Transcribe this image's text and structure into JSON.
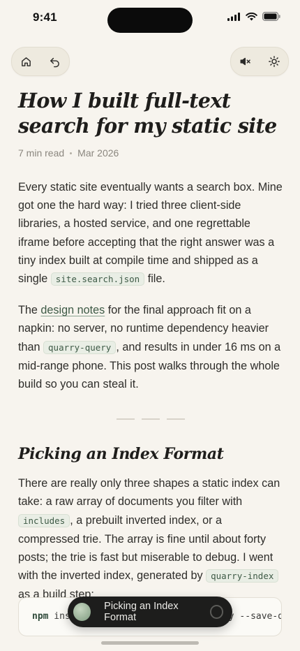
{
  "status_bar": {
    "time": "9:41"
  },
  "toolbar": {
    "home_icon": "home-icon",
    "back_icon": "undo-arrow-icon",
    "mute_icon": "speaker-muted-icon",
    "theme_icon": "sun-icon"
  },
  "article": {
    "title": "How I built full-text search for my static site",
    "read_time": "7 min read",
    "date": "Mar 2026",
    "p1": {
      "text_before": "Every static site eventually wants a search box. Mine got one the hard way: I tried three client-side libraries, a hosted service, and one regrettable iframe before accepting that the right answer was a tiny index built at compile time and shipped as a single ",
      "code": "site.search.json",
      "text_after": " file."
    },
    "p2": {
      "text_before": "The ",
      "link": "design notes",
      "text_mid": " for the final approach fit on a napkin: no server, no runtime dependency heavier than ",
      "code": "quarry-query",
      "text_after": ", and results in under 16 ms on a mid-range phone. This post walks through the whole build so you can steal it."
    },
    "section_title": "Picking an Index Format",
    "p3": {
      "text_before": "There are really only three shapes a static index can take: a raw array of documents you filter with ",
      "code1": "includes",
      "text_mid": ", a prebuilt inverted index, or a compressed trie. The array is fine until about forty posts; the trie is fast but miserable to debug. I went with the inverted index, generated by ",
      "code2": "quarry-index",
      "text_after": " as a build step:"
    },
    "code_block": {
      "cmd": "npm",
      "rest": " install quarry-index quarry-query --save-dev"
    }
  },
  "toast": {
    "label": "Picking an Index Format"
  },
  "colors": {
    "background": "#f7f4ee",
    "accent_green": "#3e5a46",
    "toast_bg": "#1d1d1c"
  }
}
